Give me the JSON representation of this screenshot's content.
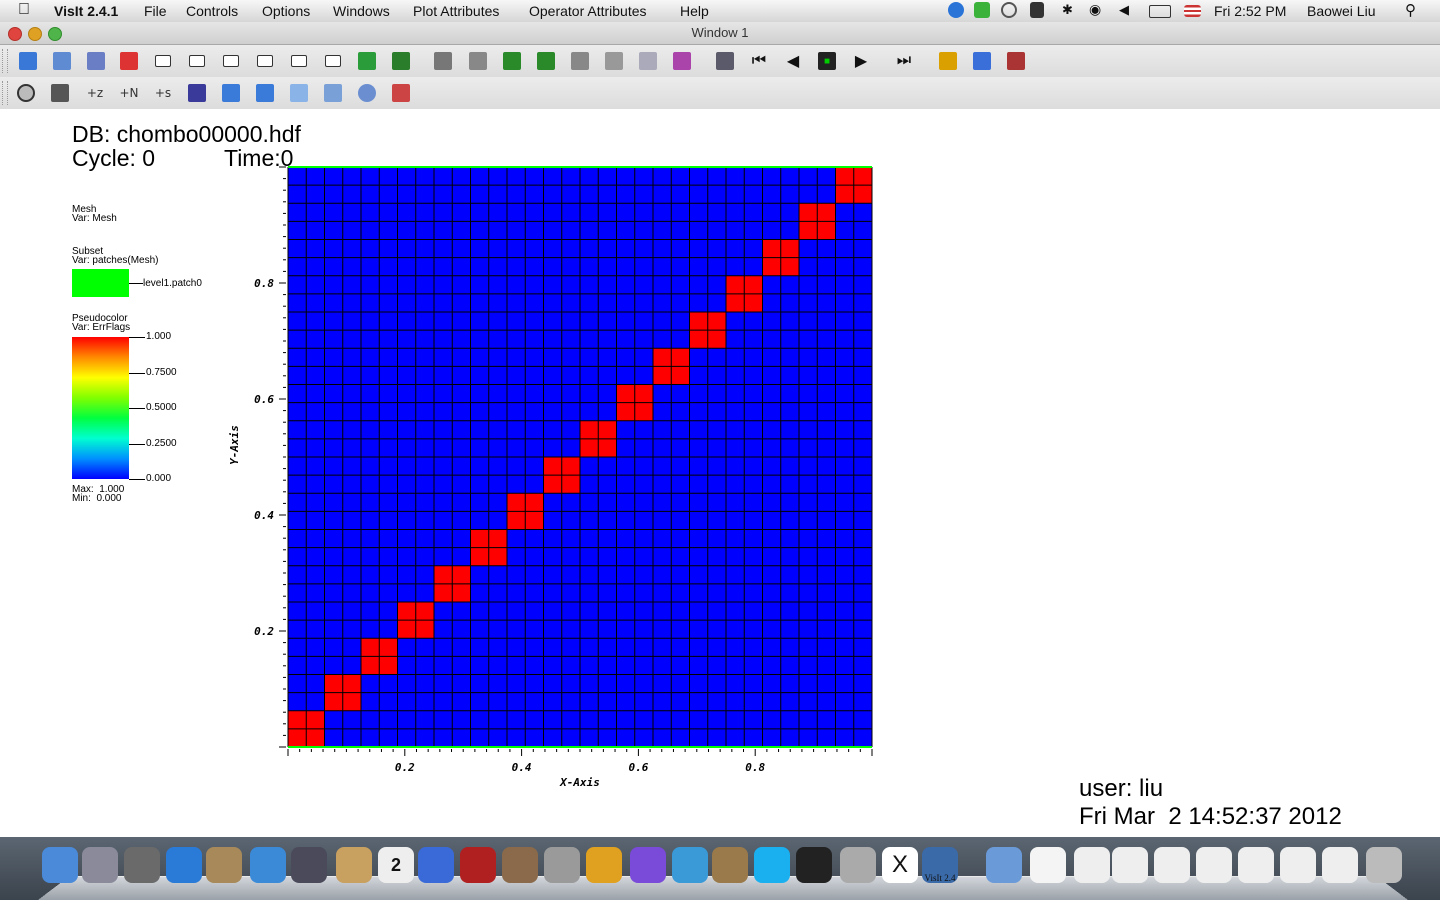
{
  "menubar": {
    "app_name": "VisIt 2.4.1",
    "menus": [
      "File",
      "Controls",
      "Options",
      "Windows",
      "Plot Attributes",
      "Operator Attributes",
      "Help"
    ],
    "clock": "Fri 2:52 PM",
    "user": "Baowei Liu"
  },
  "window": {
    "title": "Window 1"
  },
  "annotations": {
    "db": "DB: chombo00000.hdf",
    "cycle": "Cycle: 0",
    "time": "Time:0",
    "user": "user: liu",
    "date": "Fri Mar  2 14:52:37 2012"
  },
  "legend": {
    "mesh_title": "Mesh",
    "mesh_var": "Var: Mesh",
    "subset_title": "Subset",
    "subset_var": "Var: patches(Mesh)",
    "subset_item": "level1.patch0",
    "subset_color": "#00ff00",
    "pc_title": "Pseudocolor",
    "pc_var": "Var: ErrFlags",
    "pc_labels": [
      "1.000",
      "0.7500",
      "0.5000",
      "0.2500",
      "0.000"
    ],
    "pc_max": "Max:  1.000",
    "pc_min": "Min:  0.000"
  },
  "chart_data": {
    "type": "heatmap",
    "x_label": "X-Axis",
    "y_label": "Y-Axis",
    "x_ticks": [
      "0.2",
      "0.4",
      "0.6",
      "0.8"
    ],
    "y_ticks": [
      "0.2",
      "0.4",
      "0.6",
      "0.8"
    ],
    "xlim": [
      0,
      1
    ],
    "ylim": [
      0,
      1
    ],
    "grid_cells": 32,
    "background_color": "#0000ff",
    "flag_color": "#ff0000",
    "flagged_blocks": [
      {
        "x0": 0.0,
        "y0": 0.0,
        "x1": 0.0625,
        "y1": 0.0625
      },
      {
        "x0": 0.0625,
        "y0": 0.0625,
        "x1": 0.125,
        "y1": 0.125
      },
      {
        "x0": 0.125,
        "y0": 0.125,
        "x1": 0.1875,
        "y1": 0.1875
      },
      {
        "x0": 0.1875,
        "y0": 0.1875,
        "x1": 0.25,
        "y1": 0.25
      },
      {
        "x0": 0.25,
        "y0": 0.25,
        "x1": 0.3125,
        "y1": 0.3125
      },
      {
        "x0": 0.3125,
        "y0": 0.3125,
        "x1": 0.375,
        "y1": 0.375
      },
      {
        "x0": 0.375,
        "y0": 0.375,
        "x1": 0.4375,
        "y1": 0.4375
      },
      {
        "x0": 0.4375,
        "y0": 0.4375,
        "x1": 0.5,
        "y1": 0.5
      },
      {
        "x0": 0.5,
        "y0": 0.5,
        "x1": 0.5625,
        "y1": 0.5625
      },
      {
        "x0": 0.5625,
        "y0": 0.5625,
        "x1": 0.625,
        "y1": 0.625
      },
      {
        "x0": 0.625,
        "y0": 0.625,
        "x1": 0.6875,
        "y1": 0.6875
      },
      {
        "x0": 0.6875,
        "y0": 0.6875,
        "x1": 0.75,
        "y1": 0.75
      },
      {
        "x0": 0.75,
        "y0": 0.75,
        "x1": 0.8125,
        "y1": 0.8125
      },
      {
        "x0": 0.8125,
        "y0": 0.8125,
        "x1": 0.875,
        "y1": 0.875
      },
      {
        "x0": 0.875,
        "y0": 0.875,
        "x1": 0.9375,
        "y1": 0.9375
      },
      {
        "x0": 0.9375,
        "y0": 0.9375,
        "x1": 1.0,
        "y1": 1.0
      }
    ]
  },
  "toolbar1": {
    "icons": [
      "apply-icon",
      "new-window-icon",
      "clone-window-icon",
      "delete-window-icon",
      "layout-1x1-icon",
      "layout-1x2-icon",
      "layout-2x2-icon",
      "layout-2x3-icon",
      "layout-2x4-icon",
      "layout-3x3-icon",
      "lock-view-icon",
      "lock-time-icon",
      "spin-icon",
      "perspective-icon",
      "save-image-icon",
      "invert-colors-icon",
      "camera-icon",
      "camera-2-icon",
      "camera-3-icon",
      "camera-4-icon",
      "movie-icon",
      "first-frame-icon",
      "step-back-icon",
      "stop-icon",
      "play-icon",
      "step-forward-icon",
      "color-table-icon",
      "pick-1-icon",
      "pick-2-icon",
      "pick-3-icon"
    ]
  },
  "toolbar2": {
    "icons": [
      "navigate-icon",
      "zoom-icon",
      "lineout-z-icon",
      "lineout-n-icon",
      "lineout-s-icon",
      "curve-icon",
      "pick-tool-icon",
      "line-tool-icon",
      "plane-tool-icon",
      "box-tool-icon",
      "sphere-tool-icon",
      "sliders-icon"
    ],
    "labels": [
      "",
      "",
      "+z",
      "+N",
      "+s",
      "",
      "",
      "",
      "",
      "",
      "",
      ""
    ]
  },
  "dock": {
    "items": [
      "finder",
      "launchpad",
      "system-profiler",
      "app-store",
      "preview",
      "safari",
      "facetime",
      "contacts",
      "calendar",
      "itunes",
      "photo-booth",
      "iphoto",
      "system-preferences",
      "chrome",
      "eclipse",
      "word",
      "grapher",
      "skype",
      "terminal",
      "image-capture",
      "x11",
      "visit",
      "folder",
      "document",
      "window-thumb-1",
      "window-thumb-2",
      "window-thumb-3",
      "window-thumb-4",
      "window-thumb-5",
      "window-thumb-6",
      "window-thumb-7",
      "trash"
    ],
    "calendar_day": "2",
    "visit_label": "VisIt 2.4"
  }
}
